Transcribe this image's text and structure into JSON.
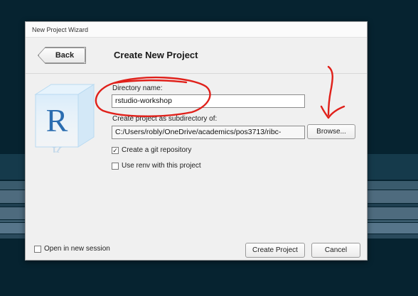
{
  "window": {
    "title": "New Project Wizard"
  },
  "header": {
    "back_label": "Back",
    "title": "Create New Project"
  },
  "form": {
    "directory_name_label": "Directory name:",
    "directory_name_value": "rstudio-workshop",
    "subdirectory_label": "Create project as subdirectory of:",
    "subdirectory_value": "C:/Users/robly/OneDrive/academics/pos3713/ribc-",
    "browse_label": "Browse...",
    "git_label": "Create a git repository",
    "git_checked": true,
    "renv_label": "Use renv with this project",
    "renv_checked": false
  },
  "footer": {
    "new_session_label": "Open in new session",
    "new_session_checked": false,
    "create_label": "Create Project",
    "cancel_label": "Cancel"
  },
  "colors": {
    "annotation": "#e0201a",
    "background": "#062330"
  }
}
